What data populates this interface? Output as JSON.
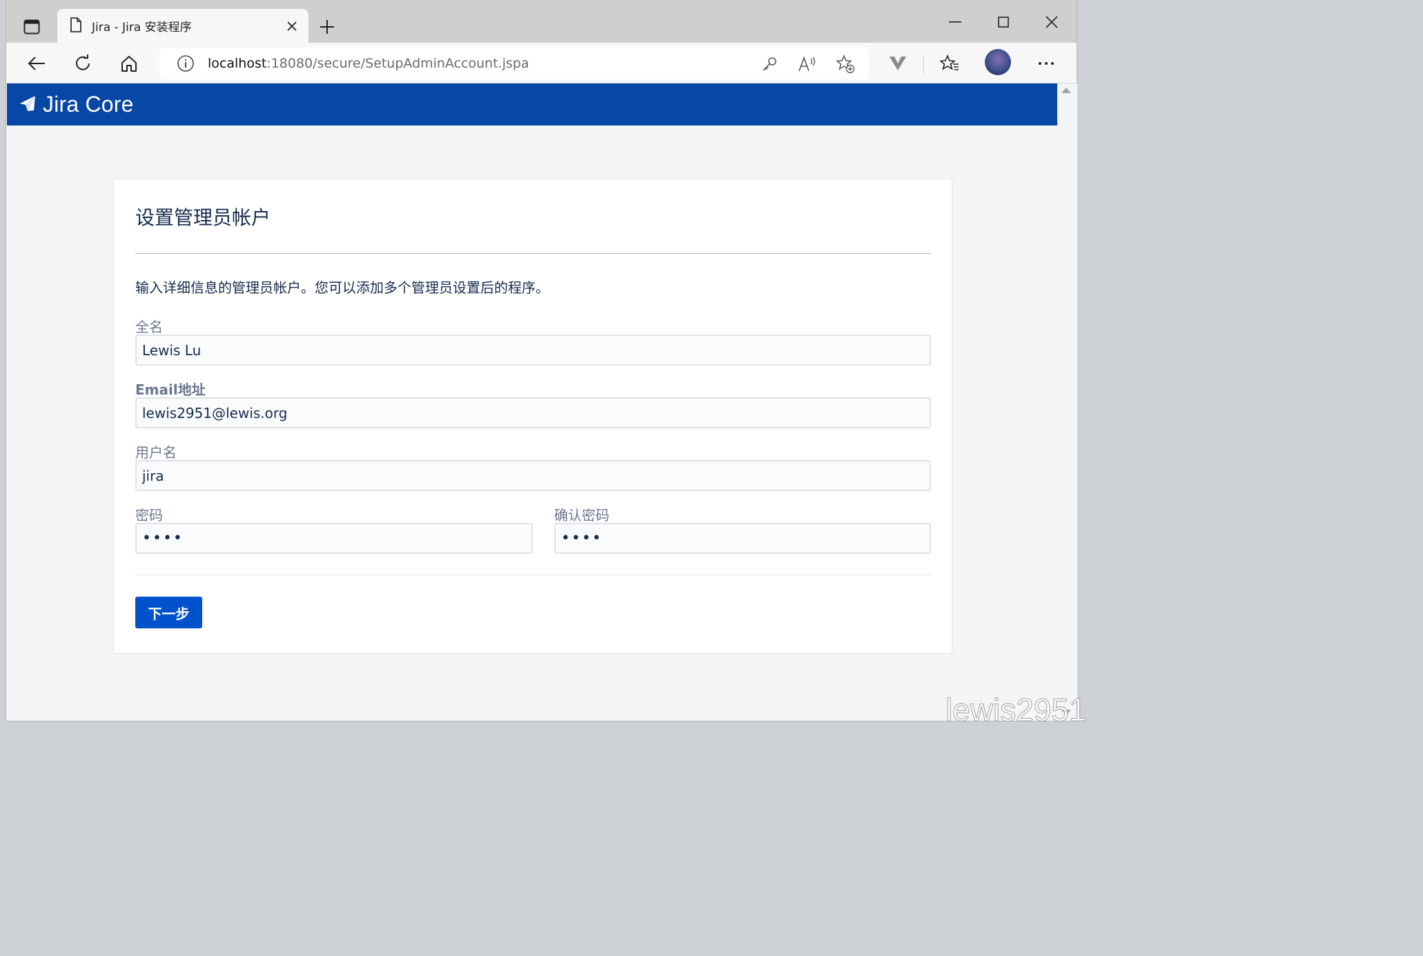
{
  "browser": {
    "tab": {
      "title": "Jira - Jira 安装程序"
    },
    "address": {
      "host": "localhost",
      "path": ":18080/secure/SetupAdminAccount.jspa"
    }
  },
  "header": {
    "product": "Jira Core"
  },
  "form": {
    "title": "设置管理员帐户",
    "description": "输入详细信息的管理员帐户。您可以添加多个管理员设置后的程序。",
    "fullname": {
      "label": "全名",
      "value": "Lewis Lu"
    },
    "email": {
      "label": "Email地址",
      "value": "lewis2951@lewis.org"
    },
    "username": {
      "label": "用户名",
      "value": "jira"
    },
    "password": {
      "label": "密码",
      "value": "••••"
    },
    "confirm": {
      "label": "确认密码",
      "value": "••••"
    },
    "next_label": "下一步"
  },
  "watermark": "lewis2951",
  "colors": {
    "header": "#0747a6",
    "button": "#0052cc",
    "text": "#172b4d",
    "label": "#6b778c"
  }
}
